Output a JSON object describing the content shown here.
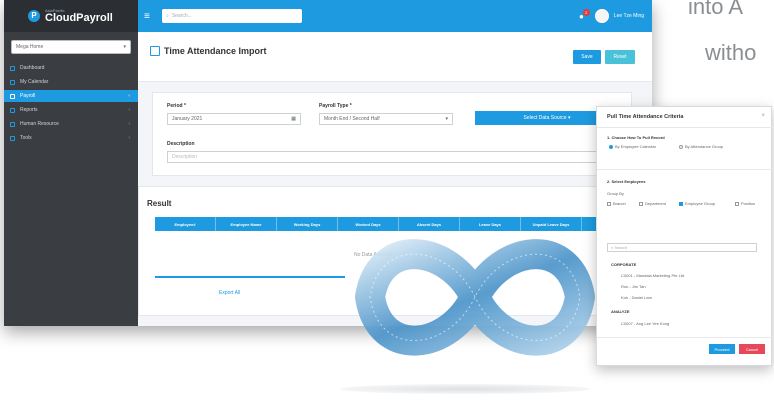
{
  "background_text": {
    "line1": "into A",
    "line2": "witho"
  },
  "app": {
    "logo_small": "AsiaPacific",
    "logo_main": "CloudPayroll",
    "company_select": "Mega Home",
    "sidebar": {
      "items": [
        {
          "label": "Dashboard"
        },
        {
          "label": "My Calendar"
        },
        {
          "label": "Payroll"
        },
        {
          "label": "Reports"
        },
        {
          "label": "Human Resource"
        },
        {
          "label": "Tools"
        }
      ]
    },
    "topbar": {
      "search_placeholder": "Search...",
      "notif_count": "2",
      "user_name": "Lee Tze Ming"
    },
    "page": {
      "title": "Time Attendance Import",
      "save_label": "Save",
      "reset_label": "Reset"
    },
    "form": {
      "period_label": "Period *",
      "period_value": "January 2021",
      "payroll_type_label": "Payroll Type *",
      "payroll_type_value": "Month End / Second Half",
      "description_label": "Description",
      "description_placeholder": "Description",
      "select_data_label": "Select Data Source ▾"
    },
    "result": {
      "title": "Result",
      "columns": [
        "Employee#",
        "Employee Name",
        "Working Days",
        "Worked Days",
        "Absent Days",
        "Leave Days",
        "Unpaid Leave Days",
        "Hours"
      ],
      "no_data": "No Data Available",
      "export_label": "Export All"
    }
  },
  "dialog": {
    "title": "Pull Time Attendance Criteria",
    "choose_label": "1. Choose How To Pull Record",
    "opt1": "By Employee Calendar",
    "opt2": "By Attendance Group",
    "select_employees_label": "2. Select Employees",
    "group_by_label": "Group By",
    "group_opts": [
      "Branch",
      "Department",
      "Employee Group",
      "Position"
    ],
    "search_placeholder": "Search",
    "tree": [
      "CORPORATE",
      "C0001 - Mandala Marketing Pte Ltd",
      "Ron - Jim Tan",
      "Koh - Daniel Lam",
      "ANALYZE",
      "C0007 - Ang Lee Yee Kong"
    ],
    "proceed_label": "Proceed",
    "cancel_label": "Cancel"
  }
}
